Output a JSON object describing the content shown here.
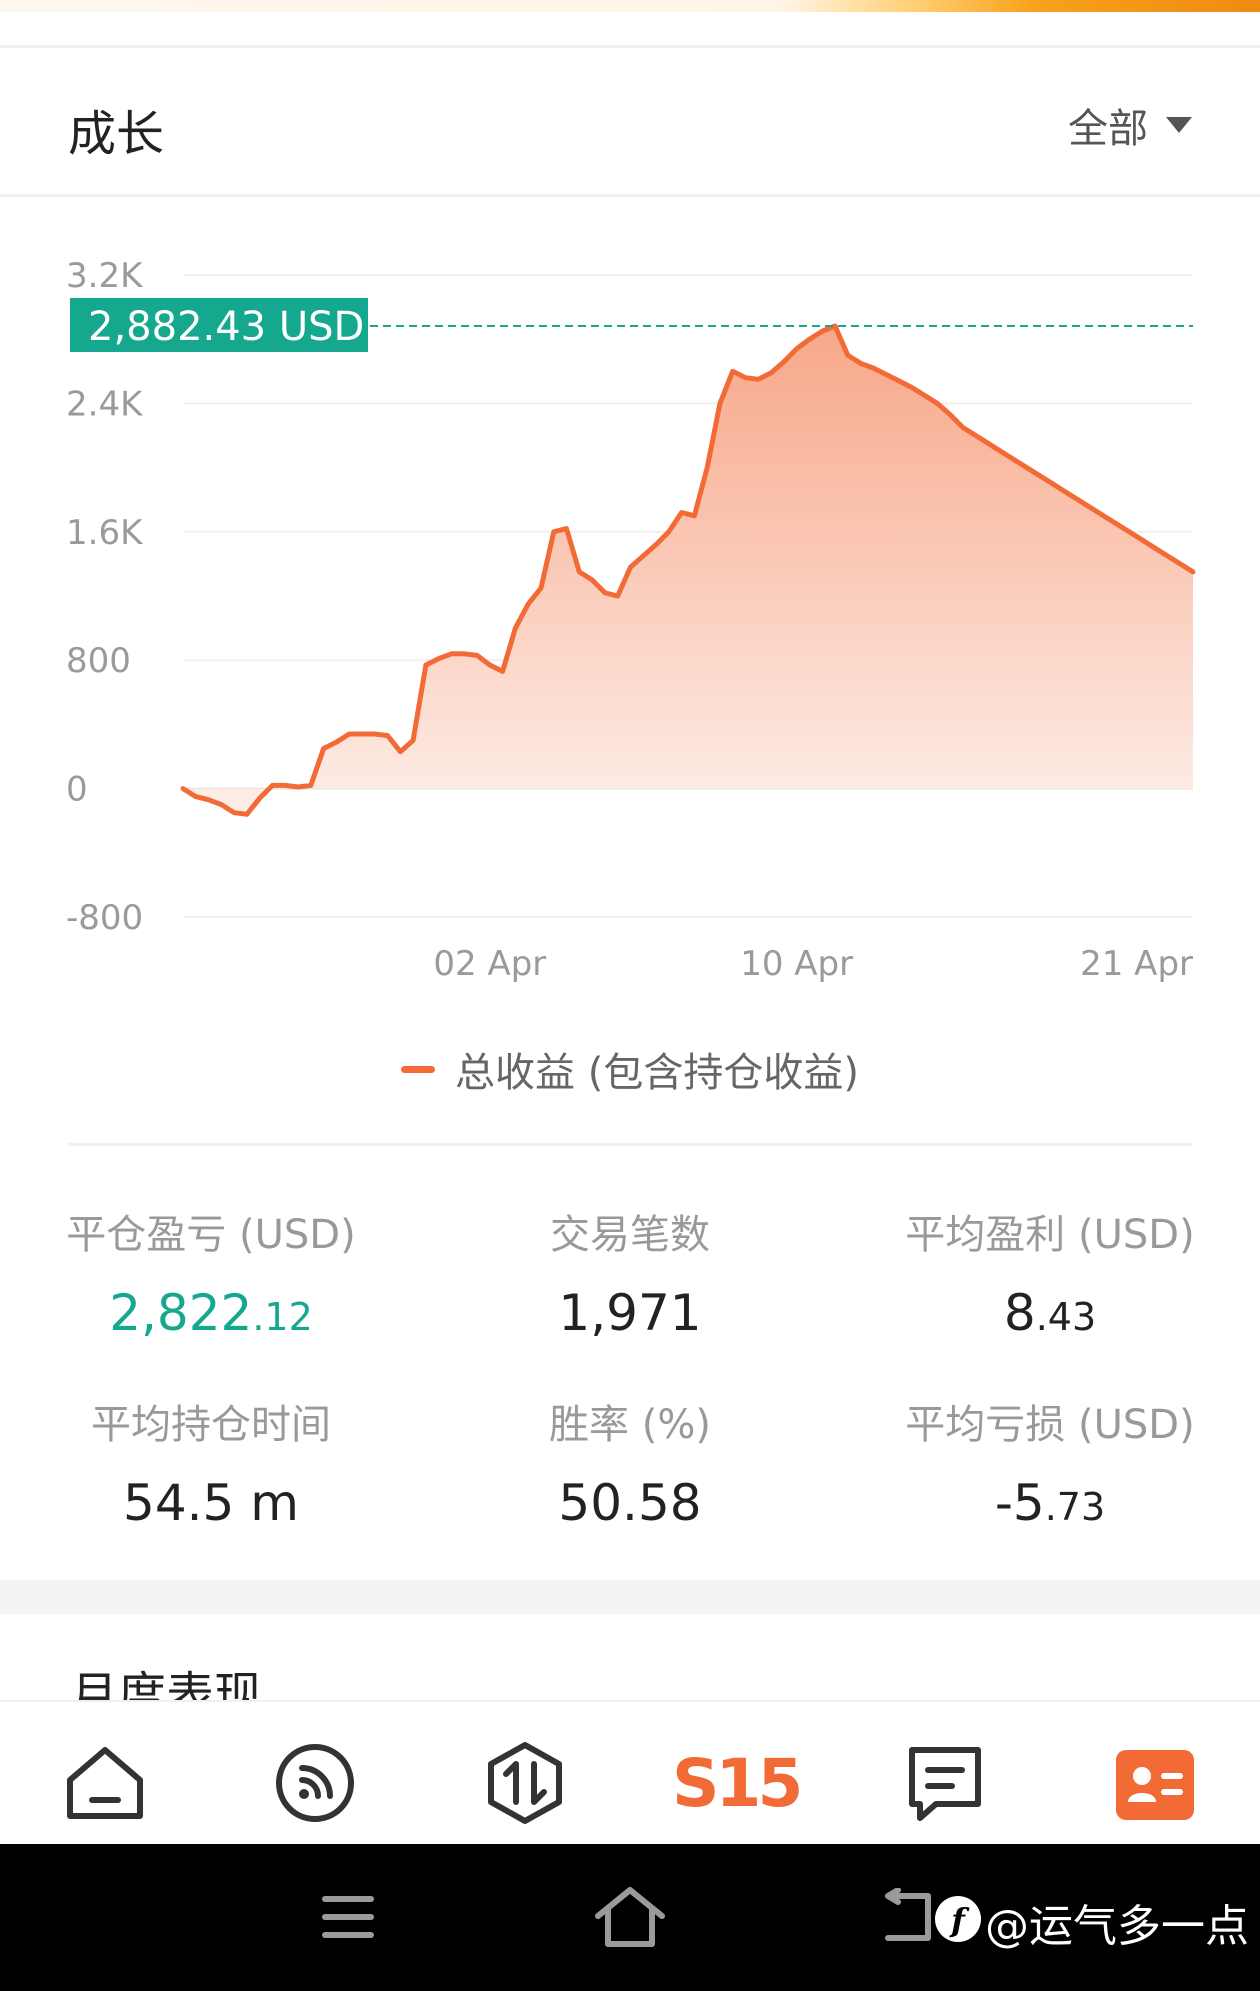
{
  "section": {
    "title": "成长"
  },
  "filter": {
    "label": "全部"
  },
  "chart_data": {
    "type": "area",
    "title": "",
    "xlabel": "",
    "ylabel": "",
    "ylim": [
      -800,
      3200
    ],
    "yticks": [
      3200,
      2400,
      1600,
      800,
      0,
      -800
    ],
    "ytick_labels": [
      "3.2K",
      "2.4K",
      "1.6K",
      "800",
      "0",
      "-800"
    ],
    "xtick_labels": [
      "02 Apr",
      "10 Apr",
      "21 Apr"
    ],
    "xtick_positions": [
      24,
      48,
      75
    ],
    "grid": true,
    "legend_placement": "bottom",
    "current_value": 2882.43,
    "current_value_label": "2,882.43 USD",
    "colors": {
      "line": "#f26b36",
      "marker": "#16a88f",
      "fill_top": "#f7a789",
      "fill_bottom": "#fdeee8"
    },
    "series": [
      {
        "name": "总收益 (包含持仓收益)",
        "x": [
          0,
          1,
          2,
          3,
          4,
          5,
          6,
          7,
          8,
          9,
          10,
          11,
          12,
          13,
          14,
          15,
          16,
          17,
          18,
          19,
          20,
          21,
          22,
          23,
          24,
          25,
          26,
          27,
          28,
          29,
          30,
          31,
          32,
          33,
          34,
          35,
          36,
          37,
          38,
          39,
          40,
          41,
          42,
          43,
          44,
          45,
          46,
          47,
          48,
          49,
          50,
          51,
          52,
          53,
          54,
          55,
          56,
          57,
          58,
          59,
          60,
          61,
          62,
          63,
          64,
          65,
          66,
          67,
          68,
          69,
          70,
          71,
          72,
          73,
          74,
          75,
          76,
          77,
          78,
          79
        ],
        "values": [
          0,
          -50,
          -70,
          -100,
          -150,
          -160,
          -60,
          20,
          20,
          10,
          20,
          250,
          290,
          340,
          340,
          340,
          330,
          230,
          300,
          770,
          810,
          840,
          840,
          830,
          770,
          730,
          1000,
          1150,
          1250,
          1600,
          1620,
          1350,
          1300,
          1220,
          1200,
          1380,
          1450,
          1520,
          1600,
          1720,
          1700,
          2000,
          2400,
          2600,
          2560,
          2550,
          2590,
          2660,
          2740,
          2800,
          2850,
          2882.43,
          2700,
          2650,
          2620,
          2580,
          2540,
          2500,
          2450,
          2400,
          2330,
          2250,
          2200,
          2150,
          2100,
          2050,
          2000,
          1950,
          1900,
          1850,
          1800,
          1750,
          1700,
          1650,
          1600,
          1550,
          1500,
          1450,
          1400,
          1350
        ]
      }
    ]
  },
  "stats": {
    "closed_pnl": {
      "label": "平仓盈亏 (USD)",
      "int": "2,822",
      "frac": ".12"
    },
    "trade_count": {
      "label": "交易笔数",
      "value": "1,971"
    },
    "avg_profit": {
      "label": "平均盈利 (USD)",
      "int": "8",
      "frac": ".43"
    },
    "avg_hold_time": {
      "label": "平均持仓时间",
      "value": "54.5 m"
    },
    "win_rate": {
      "label": "胜率 (%)",
      "value": "50.58"
    },
    "avg_loss": {
      "label": "平均亏损 (USD)",
      "int": "-5",
      "frac": ".73"
    }
  },
  "section2": {
    "title": "月度表现"
  },
  "tabbar": {
    "tabs": [
      {
        "icon": "home-icon"
      },
      {
        "icon": "feed-icon"
      },
      {
        "icon": "trade-icon"
      },
      {
        "label": "S15"
      },
      {
        "icon": "message-icon"
      },
      {
        "icon": "profile-card-icon"
      }
    ]
  },
  "watermark": {
    "text": "@运气多一点"
  }
}
